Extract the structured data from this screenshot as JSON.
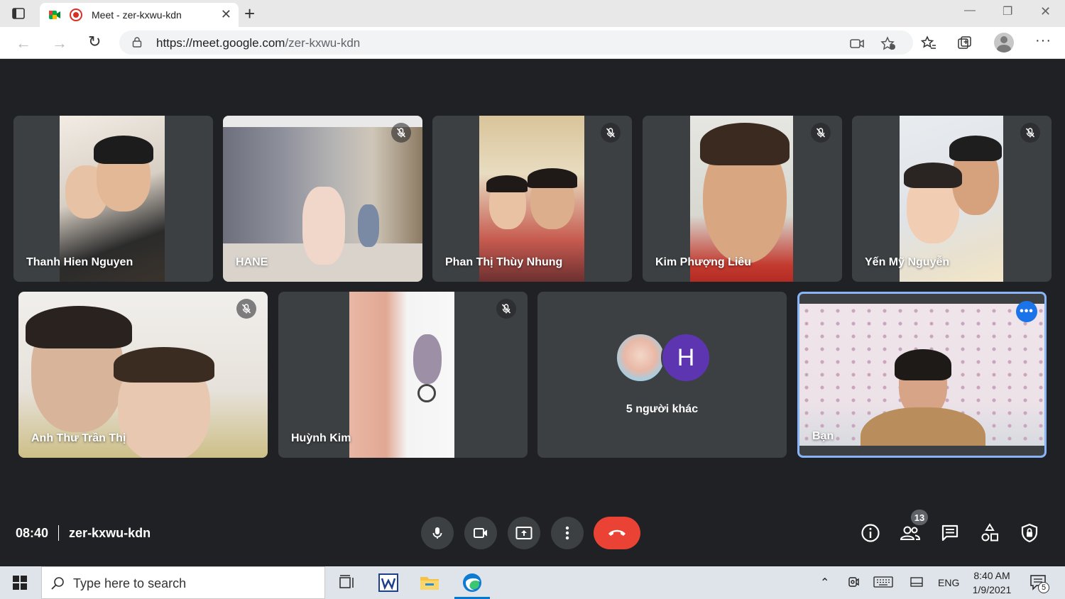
{
  "browser": {
    "tab_title": "Meet - zer-kxwu-kdn",
    "url_host": "https://meet.google.com",
    "url_path": "/zer-kxwu-kdn"
  },
  "tiles": [
    {
      "name": "Thanh Hien Nguyen",
      "muted": false
    },
    {
      "name": "HANE",
      "muted": true
    },
    {
      "name": "Phan Thị Thùy Nhung",
      "muted": true
    },
    {
      "name": "Kim Phượng Liêu",
      "muted": true
    },
    {
      "name": "Yến Mỹ Nguyễn",
      "muted": true
    },
    {
      "name": "Anh Thư Trần Thị",
      "muted": true
    },
    {
      "name": "Huỳnh Kim",
      "muted": true
    }
  ],
  "others": {
    "avatar_letter": "H",
    "label": "5 người khác"
  },
  "self_tile": {
    "name": "Bạn",
    "more_icon": "more-horizontal-icon"
  },
  "meeting": {
    "time": "08:40",
    "code": "zer-kxwu-kdn",
    "participants_count": "13"
  },
  "colors": {
    "hangup": "#ea4335",
    "accent": "#1a73e8",
    "self_border": "#8ab4f8",
    "avatar_purple": "#5e35b1"
  },
  "taskbar": {
    "search_placeholder": "Type here to search",
    "language": "ENG",
    "time": "8:40 AM",
    "date": "1/9/2021",
    "notifications": "5"
  }
}
